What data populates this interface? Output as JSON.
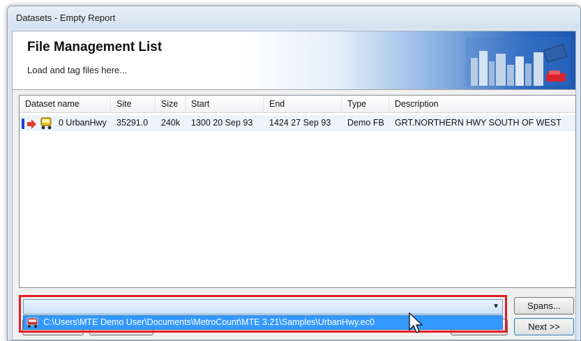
{
  "window": {
    "title": "Datasets - Empty Report"
  },
  "banner": {
    "heading": "File Management List",
    "subtitle": "Load and tag files here..."
  },
  "list": {
    "columns": [
      "Dataset name",
      "Site",
      "Size",
      "Start",
      "End",
      "Type",
      "Description"
    ],
    "rows": [
      {
        "dataset_name": "0 UrbanHwy",
        "site": "35291.0",
        "size": "240k",
        "start": "1300 20 Sep 93",
        "end": "1424 27 Sep 93",
        "type": "Demo FB",
        "description": "GRT.NORTHERN HWY SOUTH OF WEST",
        "icons": [
          "tag-marker-icon",
          "arrow-right-icon",
          "traffic-counter-icon"
        ]
      }
    ]
  },
  "file_combo": {
    "value": "",
    "dropdown_item": "C:\\Users\\MTE Demo User\\Documents\\MetroCount\\MTE 3.21\\Samples\\UrbanHwy.ec0"
  },
  "buttons": {
    "spans": "Spans...",
    "next": "Next >>"
  },
  "colors": {
    "highlight": "#e51c23",
    "selection": "#3399ff",
    "banner_blue": "#1d57b0"
  }
}
